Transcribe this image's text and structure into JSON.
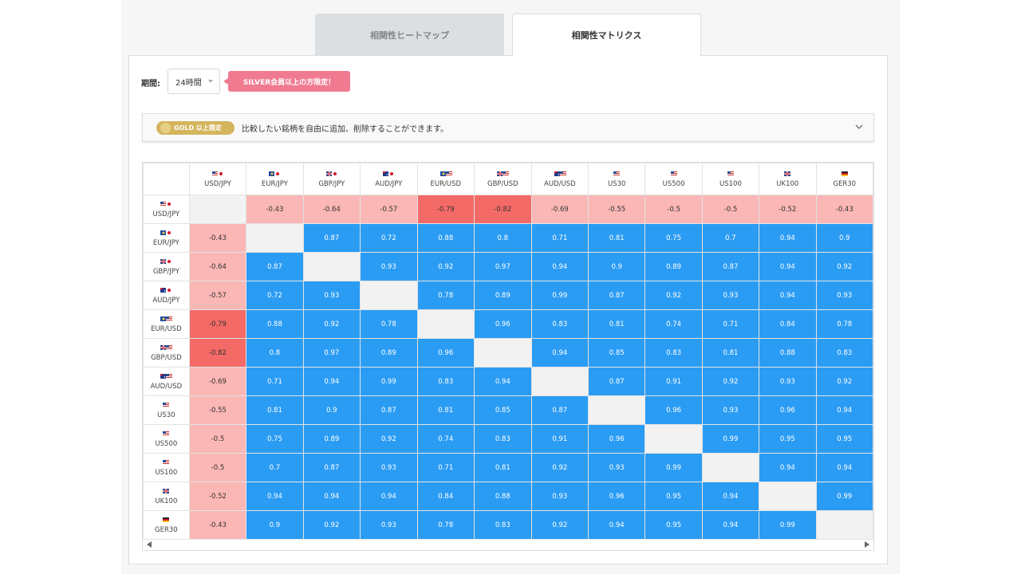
{
  "tabs": [
    {
      "label": "相関性ヒートマップ",
      "active": false
    },
    {
      "label": "相関性マトリクス",
      "active": true
    }
  ],
  "period": {
    "label": "期間:",
    "value": "24時間"
  },
  "silver_badge": "SILVER会員以上の方限定！",
  "info": {
    "gold_badge": "GOLD 以上限定",
    "text": "比較したい銘柄を自由に追加、削除することができます。"
  },
  "colors": {
    "positive": "#2b9cf4",
    "negative_light": "#fbb7b5",
    "negative_strong": "#f46a67",
    "diagonal": "#f2f2f2"
  },
  "symbols": [
    {
      "label": "USD/JPY",
      "flags": [
        "us",
        "jp"
      ]
    },
    {
      "label": "EUR/JPY",
      "flags": [
        "eu",
        "jp"
      ]
    },
    {
      "label": "GBP/JPY",
      "flags": [
        "gb",
        "jp"
      ]
    },
    {
      "label": "AUD/JPY",
      "flags": [
        "au",
        "jp"
      ]
    },
    {
      "label": "EUR/USD",
      "flags": [
        "eu",
        "us"
      ]
    },
    {
      "label": "GBP/USD",
      "flags": [
        "gb",
        "us"
      ]
    },
    {
      "label": "AUD/USD",
      "flags": [
        "au",
        "us"
      ]
    },
    {
      "label": "US30",
      "flags": [
        "us"
      ]
    },
    {
      "label": "US500",
      "flags": [
        "us"
      ]
    },
    {
      "label": "US100",
      "flags": [
        "us"
      ]
    },
    {
      "label": "UK100",
      "flags": [
        "gb"
      ]
    },
    {
      "label": "GER30",
      "flags": [
        "de"
      ]
    }
  ],
  "matrix": [
    [
      null,
      "-0.43",
      "-0.64",
      "-0.57",
      "-0.79",
      "-0.82",
      "-0.69",
      "-0.55",
      "-0.5",
      "-0.5",
      "-0.52",
      "-0.43"
    ],
    [
      "-0.43",
      null,
      "0.87",
      "0.72",
      "0.88",
      "0.8",
      "0.71",
      "0.81",
      "0.75",
      "0.7",
      "0.94",
      "0.9"
    ],
    [
      "-0.64",
      "0.87",
      null,
      "0.93",
      "0.92",
      "0.97",
      "0.94",
      "0.9",
      "0.89",
      "0.87",
      "0.94",
      "0.92"
    ],
    [
      "-0.57",
      "0.72",
      "0.93",
      null,
      "0.78",
      "0.89",
      "0.99",
      "0.87",
      "0.92",
      "0.93",
      "0.94",
      "0.93"
    ],
    [
      "-0.79",
      "0.88",
      "0.92",
      "0.78",
      null,
      "0.96",
      "0.83",
      "0.81",
      "0.74",
      "0.71",
      "0.84",
      "0.78"
    ],
    [
      "-0.82",
      "0.8",
      "0.97",
      "0.89",
      "0.96",
      null,
      "0.94",
      "0.85",
      "0.83",
      "0.81",
      "0.88",
      "0.83"
    ],
    [
      "-0.69",
      "0.71",
      "0.94",
      "0.99",
      "0.83",
      "0.94",
      null,
      "0.87",
      "0.91",
      "0.92",
      "0.93",
      "0.92"
    ],
    [
      "-0.55",
      "0.81",
      "0.9",
      "0.87",
      "0.81",
      "0.85",
      "0.87",
      null,
      "0.96",
      "0.93",
      "0.96",
      "0.94"
    ],
    [
      "-0.5",
      "0.75",
      "0.89",
      "0.92",
      "0.74",
      "0.83",
      "0.91",
      "0.96",
      null,
      "0.99",
      "0.95",
      "0.95"
    ],
    [
      "-0.5",
      "0.7",
      "0.87",
      "0.93",
      "0.71",
      "0.81",
      "0.92",
      "0.93",
      "0.99",
      null,
      "0.94",
      "0.94"
    ],
    [
      "-0.52",
      "0.94",
      "0.94",
      "0.94",
      "0.84",
      "0.88",
      "0.93",
      "0.96",
      "0.95",
      "0.94",
      null,
      "0.99"
    ],
    [
      "-0.43",
      "0.9",
      "0.92",
      "0.93",
      "0.78",
      "0.83",
      "0.92",
      "0.94",
      "0.95",
      "0.94",
      "0.99",
      null
    ]
  ]
}
